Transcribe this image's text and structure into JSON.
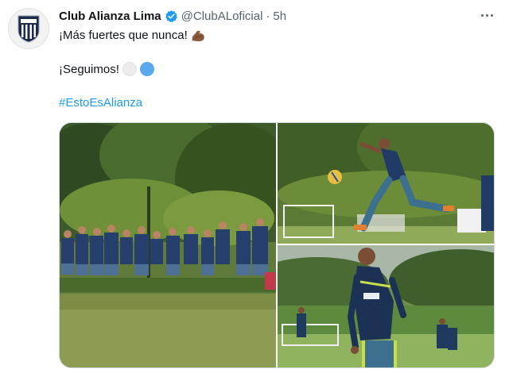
{
  "tweet": {
    "author_name": "Club Alianza Lima",
    "author_handle": "@ClubALoficial",
    "separator": "·",
    "timestamp": "5h",
    "line1_text": "¡Más fuertes que nunca!",
    "line1_emoji": "flexed-biceps-icon",
    "line2_text": "¡Seguimos!",
    "line2_emojis": [
      "white-circle-icon",
      "blue-circle-icon"
    ],
    "hashtag": "#EstoEsAlianza"
  },
  "media": {
    "photos": [
      "team-huddle-photo",
      "volley-kick-photo",
      "player-running-photo"
    ]
  },
  "colors": {
    "link": "#1d9bf0",
    "verified": "#1d9bf0",
    "muted": "#536471",
    "kit_blue": "#1e3a5f"
  }
}
